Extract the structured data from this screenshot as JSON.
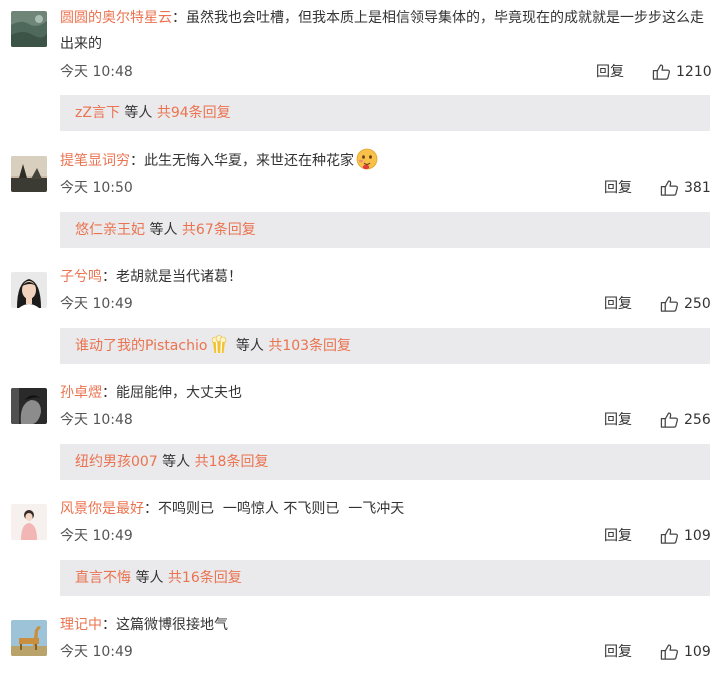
{
  "comments": [
    {
      "username": "圆圆的奥尔特星云",
      "separator": "：",
      "text": "虽然我也会吐槽，但我本质上是相信领导集体的，毕竟现在的成就就是一步步这么走出来的",
      "time": "今天 10:48",
      "reply_label": "回复",
      "likes": "1210",
      "avatar_icon": "landscape-avatar",
      "sub_reply": {
        "names": "zZ言下",
        "middle": " 等人 ",
        "total": "共94条回复"
      }
    },
    {
      "username": "提笔显词穷",
      "separator": "：",
      "text": "此生无悔入华夏，来世还在种花家",
      "emoji": "drooling-face-emoji",
      "time": "今天 10:50",
      "reply_label": "回复",
      "likes": "381",
      "avatar_icon": "sunset-tree-avatar",
      "sub_reply": {
        "names": "悠仁亲王妃",
        "middle": " 等人 ",
        "total": "共67条回复"
      }
    },
    {
      "username": "子兮鸣",
      "separator": "：",
      "text": "老胡就是当代诸葛！",
      "time": "今天 10:49",
      "reply_label": "回复",
      "likes": "250",
      "avatar_icon": "girl-portrait-avatar",
      "sub_reply": {
        "names": "谁动了我的Pistachio",
        "names_emoji": "popcorn-emoji",
        "middle": " 等人 ",
        "total": "共103条回复"
      }
    },
    {
      "username": "孙卓熤",
      "separator": "：",
      "text": "能屈能伸，大丈夫也",
      "time": "今天 10:48",
      "reply_label": "回复",
      "likes": "256",
      "avatar_icon": "monochrome-profile-avatar",
      "sub_reply": {
        "names": "纽约男孩007",
        "middle": " 等人 ",
        "total": "共18条回复"
      }
    },
    {
      "username": "风景你是最好",
      "separator": "：",
      "text": "不鸣则已  一鸣惊人 不飞则已  一飞冲天",
      "time": "今天 10:49",
      "reply_label": "回复",
      "likes": "109",
      "avatar_icon": "pink-figure-avatar",
      "sub_reply": {
        "names": "直言不悔",
        "middle": " 等人 ",
        "total": "共16条回复"
      }
    },
    {
      "username": "理记中",
      "separator": "：",
      "text": "这篇微博很接地气",
      "time": "今天 10:49",
      "reply_label": "回复",
      "likes": "109",
      "avatar_icon": "giraffe-avatar"
    }
  ],
  "colors": {
    "username": "#eb7350",
    "text": "#333333",
    "time": "#555555",
    "sub_box_bg": "#eaeaec"
  }
}
